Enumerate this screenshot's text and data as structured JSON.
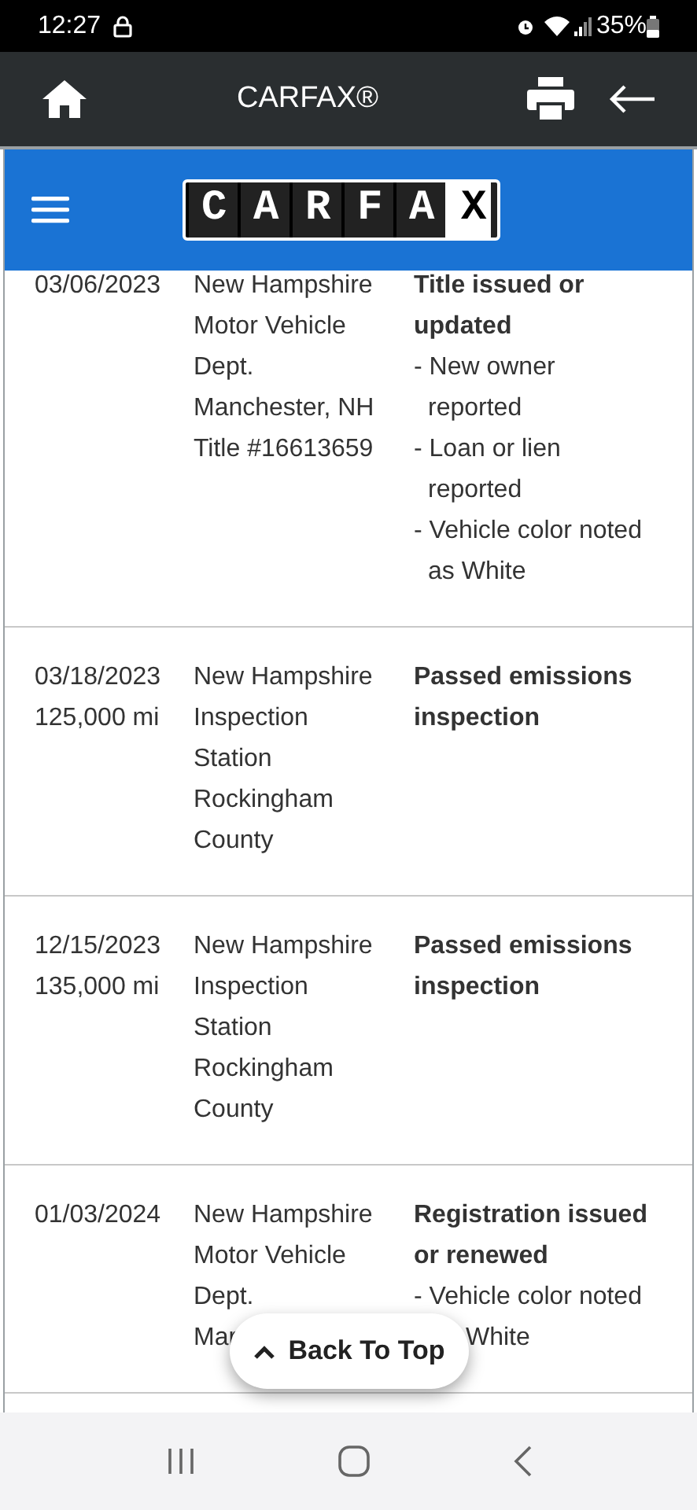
{
  "status_bar": {
    "time": "12:27",
    "battery": "35%"
  },
  "app_bar": {
    "title": "CARFAX®"
  },
  "site_header": {
    "logo_text": "CARFAX"
  },
  "records": [
    {
      "date": "03/06/2023",
      "source": [
        "New Hampshire",
        "Motor Vehicle",
        "Dept.",
        "Manchester, NH",
        "Title #16613659"
      ],
      "event": [
        "Title issued or",
        "updated"
      ],
      "details": [
        "- New owner\nreported",
        "- Loan or lien\nreported",
        "- Vehicle color noted\nas White"
      ]
    },
    {
      "date": "03/18/2023",
      "mileage": "125,000 mi",
      "source": [
        "New Hampshire",
        "Inspection",
        "Station",
        "Rockingham",
        "County"
      ],
      "event": [
        "Passed emissions",
        "inspection"
      ]
    },
    {
      "date": "12/15/2023",
      "mileage": "135,000 mi",
      "source": [
        "New Hampshire",
        "Inspection",
        "Station",
        "Rockingham",
        "County"
      ],
      "event": [
        "Passed emissions",
        "inspection"
      ]
    },
    {
      "date": "01/03/2024",
      "source": [
        "New Hampshire",
        "Motor Vehicle",
        "Dept.",
        "Mar"
      ],
      "event": [
        "Registration issued",
        "or renewed"
      ],
      "details": [
        "- Vehicle color noted"
      ],
      "covered_tail": "White"
    }
  ],
  "back_to_top": {
    "label": "Back To Top"
  }
}
